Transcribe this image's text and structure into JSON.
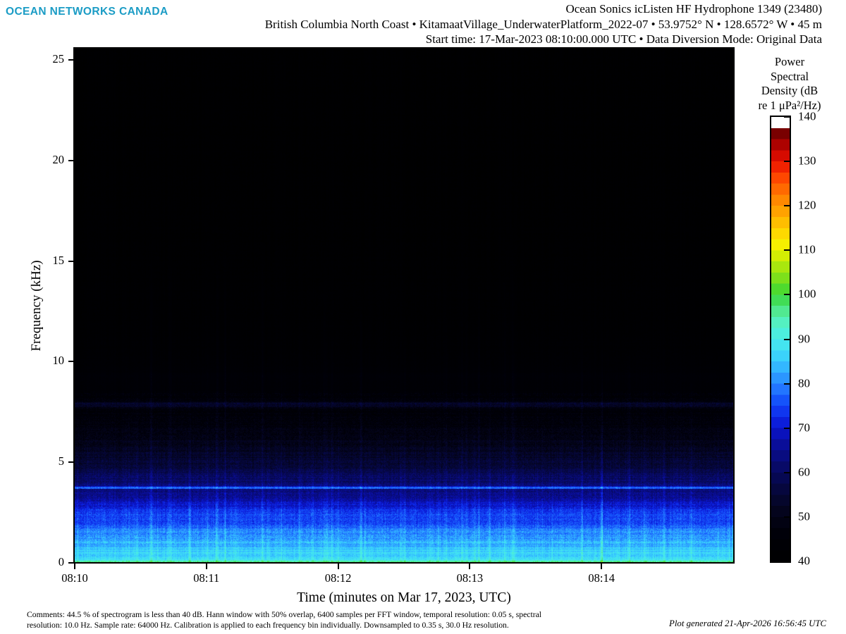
{
  "branding": {
    "logo": "OCEAN NETWORKS CANADA",
    "logo_color": "#1b9cc5"
  },
  "header": {
    "line1": "Ocean Sonics icListen HF Hydrophone 1349 (23480)",
    "line2": "British Columbia North Coast • KitamaatVillage_UnderwaterPlatform_2022-07 • 53.9752° N • 128.6572° W • 45 m",
    "line3": "Start time: 17-Mar-2023 08:10:00.000 UTC • Data Diversion Mode: Original Data"
  },
  "footer": {
    "comments_line1": "Comments: 44.5 % of spectrogram is less than 40 dB. Hann window with 50% overlap, 6400 samples per FFT window, temporal resolution: 0.05 s, spectral",
    "comments_line2": "resolution: 10.0 Hz. Sample rate: 64000 Hz. Calibration is applied to each frequency bin individually. Downsampled to 0.35 s, 30.0 Hz resolution.",
    "generated": "Plot generated 21-Apr-2026 16:56:45 UTC"
  },
  "chart_data": {
    "type": "heatmap",
    "subtype": "spectrogram",
    "xlabel": "Time (minutes on Mar 17, 2023, UTC)",
    "ylabel": "Frequency (kHz)",
    "x_ticks": [
      {
        "label": "08:10",
        "frac": 0.0
      },
      {
        "label": "08:11",
        "frac": 0.2
      },
      {
        "label": "08:12",
        "frac": 0.4
      },
      {
        "label": "08:13",
        "frac": 0.6
      },
      {
        "label": "08:14",
        "frac": 0.8
      }
    ],
    "x_span_minutes": 5,
    "y_ticks_khz": [
      0,
      5,
      10,
      15,
      20,
      25
    ],
    "y_max_khz": 25.6,
    "colorbar": {
      "title_lines": [
        "Power",
        "Spectral",
        "Density (dB",
        "re 1 μPa²/Hz)"
      ],
      "ticks_db": [
        40,
        50,
        60,
        70,
        80,
        90,
        100,
        110,
        120,
        130,
        140
      ],
      "range_db": [
        40,
        140
      ],
      "step_db": 2.5
    },
    "colormap_stops": [
      [
        40,
        0,
        0,
        0
      ],
      [
        46,
        0,
        0,
        8
      ],
      [
        50,
        3,
        3,
        22
      ],
      [
        54,
        5,
        6,
        45
      ],
      [
        58,
        6,
        8,
        75
      ],
      [
        62,
        8,
        10,
        110
      ],
      [
        66,
        10,
        14,
        150
      ],
      [
        70,
        10,
        20,
        205
      ],
      [
        73,
        15,
        45,
        235
      ],
      [
        76,
        20,
        80,
        250
      ],
      [
        79,
        35,
        120,
        255
      ],
      [
        82,
        45,
        160,
        255
      ],
      [
        85,
        55,
        200,
        255
      ],
      [
        88,
        65,
        225,
        245
      ],
      [
        91,
        75,
        238,
        225
      ],
      [
        94,
        85,
        240,
        190
      ],
      [
        97,
        80,
        230,
        130
      ],
      [
        100,
        55,
        215,
        55
      ],
      [
        104,
        130,
        225,
        25
      ],
      [
        108,
        200,
        235,
        5
      ],
      [
        111,
        245,
        242,
        0
      ],
      [
        114,
        255,
        215,
        0
      ],
      [
        118,
        255,
        170,
        0
      ],
      [
        122,
        255,
        128,
        0
      ],
      [
        126,
        255,
        75,
        0
      ],
      [
        129,
        240,
        30,
        0
      ],
      [
        132,
        205,
        5,
        0
      ],
      [
        135,
        150,
        0,
        0
      ],
      [
        137.4,
        95,
        0,
        0
      ],
      [
        137.5,
        255,
        255,
        255
      ],
      [
        140,
        255,
        255,
        255
      ]
    ],
    "band_profile_khz_db": [
      [
        0.0,
        97
      ],
      [
        0.05,
        93
      ],
      [
        0.1,
        87.5
      ],
      [
        0.55,
        86
      ],
      [
        0.85,
        84
      ],
      [
        1.25,
        81.5
      ],
      [
        1.55,
        80
      ],
      [
        1.8,
        77
      ],
      [
        2.0,
        74.5
      ],
      [
        2.35,
        74.5
      ],
      [
        2.7,
        71
      ],
      [
        3.05,
        67
      ],
      [
        3.4,
        64
      ],
      [
        3.62,
        62.5
      ],
      [
        3.66,
        76
      ],
      [
        3.72,
        79
      ],
      [
        3.78,
        64
      ],
      [
        4.0,
        61.5
      ],
      [
        4.35,
        59
      ],
      [
        4.8,
        56
      ],
      [
        5.3,
        53
      ],
      [
        5.8,
        50.5
      ],
      [
        6.4,
        48
      ],
      [
        7.1,
        46
      ],
      [
        7.6,
        45
      ],
      [
        7.74,
        50.5
      ],
      [
        7.8,
        53
      ],
      [
        7.86,
        51
      ],
      [
        7.92,
        55
      ],
      [
        8.0,
        45.5
      ],
      [
        8.6,
        43.8
      ],
      [
        9.35,
        44.6
      ],
      [
        9.5,
        43.4
      ],
      [
        10.5,
        42.4
      ],
      [
        12.0,
        41.8
      ],
      [
        16.0,
        41.4
      ],
      [
        25.6,
        41.2
      ]
    ],
    "texture": {
      "seed": 23480,
      "streak_count": 95,
      "strong_streaks": [
        {
          "frac": 0.285,
          "top_khz": 16,
          "db": 5.5
        },
        {
          "frac": 0.435,
          "top_khz": 13,
          "db": 4.5
        },
        {
          "frac": 0.665,
          "top_khz": 17,
          "db": 5.0
        },
        {
          "frac": 0.77,
          "top_khz": 12,
          "db": 4.0
        }
      ]
    }
  }
}
